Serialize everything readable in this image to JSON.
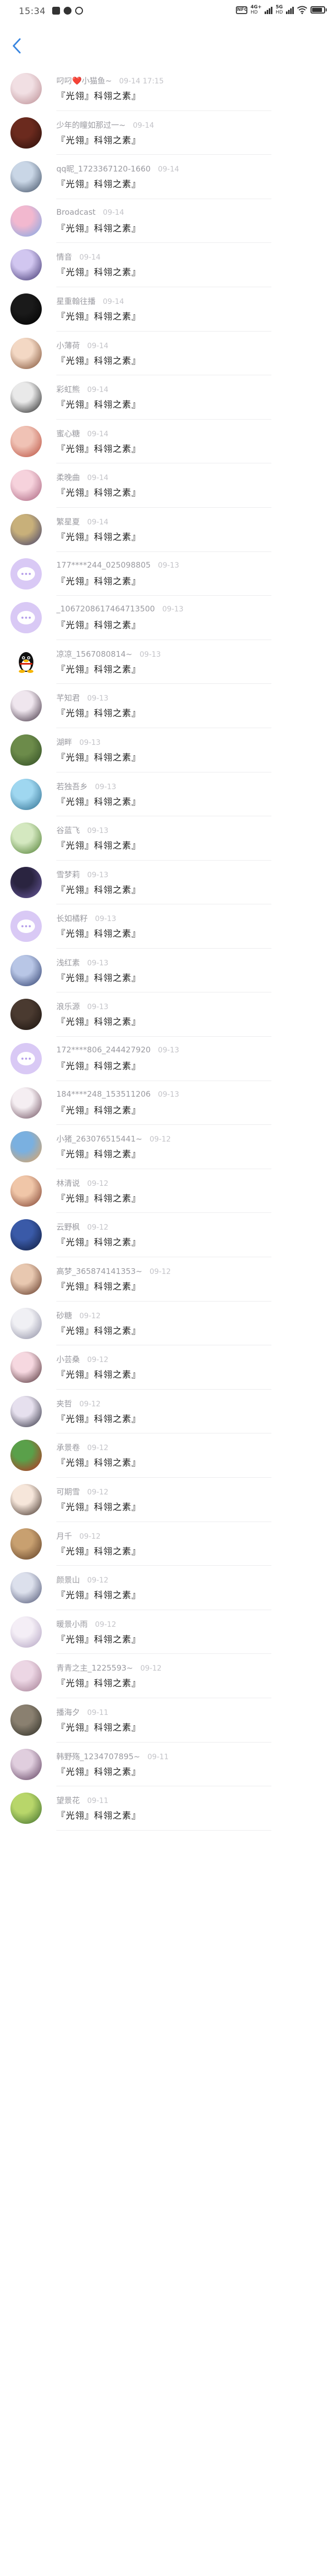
{
  "status_bar": {
    "time": "15:34",
    "nfc": "NFC",
    "network_1": {
      "top": "4G+",
      "bottom": "HD"
    },
    "network_2": {
      "top": "5G",
      "bottom": "HD"
    },
    "battery_level": 0.85
  },
  "nav": {
    "back_icon": "chevron-left-icon"
  },
  "colors": {
    "default_avatar": "#d9c9f5",
    "back": "#3a86e0"
  },
  "rows": [
    {
      "nick": "叼叼❤️小猫鱼~",
      "time": "09-14 17:15",
      "msg": "『光翎』科翎之素』",
      "avatar": [
        "#f1dfe3",
        "#b98a90"
      ]
    },
    {
      "nick": "少年的瞳如那过一~",
      "time": "09-14",
      "msg": "『光翎』科翎之素』",
      "avatar": [
        "#6b2a1e",
        "#2a0f0a"
      ]
    },
    {
      "nick": "qq昵_1723367120-1660",
      "time": "09-14",
      "msg": "『光翎』科翎之素』",
      "avatar": [
        "#c9d6e6",
        "#3b4a5f"
      ]
    },
    {
      "nick": "Broadcast",
      "time": "09-14",
      "msg": "『光翎』科翎之素』",
      "avatar": [
        "#f2b8cf",
        "#7aa7e6"
      ]
    },
    {
      "nick": "情音",
      "time": "09-14",
      "msg": "『光翎』科翎之素』",
      "avatar": [
        "#d1c6f0",
        "#3a2f6b"
      ]
    },
    {
      "nick": "星重翰往播",
      "time": "09-14",
      "msg": "『光翎』科翎之素』",
      "avatar": [
        "#1a1a1a",
        "#000000"
      ]
    },
    {
      "nick": "小薄荷",
      "time": "09-14",
      "msg": "『光翎』科翎之素』",
      "avatar": [
        "#f3d8c4",
        "#7a4a2e"
      ]
    },
    {
      "nick": "彩虹熊",
      "time": "09-14",
      "msg": "『光翎』科翎之素』",
      "avatar": [
        "#e9e9e9",
        "#1c1c1c"
      ]
    },
    {
      "nick": "蜜心糖",
      "time": "09-14",
      "msg": "『光翎』科翎之素』",
      "avatar": [
        "#f0c2b5",
        "#b84b3a"
      ]
    },
    {
      "nick": "柔晚曲",
      "time": "09-14",
      "msg": "『光翎』科翎之素』",
      "avatar": [
        "#f6d2dc",
        "#a65e7a"
      ]
    },
    {
      "nick": "繁星夏",
      "time": "09-14",
      "msg": "『光翎』科翎之素』",
      "avatar": [
        "#c8b07a",
        "#3f3d6b"
      ]
    },
    {
      "nick": "177****244_025098805",
      "time": "09-13",
      "msg": "『光翎』科翎之素』",
      "avatar": "default"
    },
    {
      "nick": "_1067208617464713500",
      "time": "09-13",
      "msg": "『光翎』科翎之素』",
      "avatar": "default"
    },
    {
      "nick": "凉凉_1567080814~",
      "time": "09-13",
      "msg": "『光翎』科翎之素』",
      "avatar": "qq"
    },
    {
      "nick": "芊知君",
      "time": "09-13",
      "msg": "『光翎』科翎之素』",
      "avatar": [
        "#efe6ee",
        "#3a2a3a"
      ]
    },
    {
      "nick": "湖畔",
      "time": "09-13",
      "msg": "『光翎』科翎之素』",
      "avatar": [
        "#6c8b4a",
        "#2e4a22"
      ]
    },
    {
      "nick": "若独吾乡",
      "time": "09-13",
      "msg": "『光翎』科翎之素』",
      "avatar": [
        "#9fd7f0",
        "#2a6a8c"
      ]
    },
    {
      "nick": "谷蓝飞",
      "time": "09-13",
      "msg": "『光翎』科翎之素』",
      "avatar": [
        "#d4e8c0",
        "#4a7a2c"
      ]
    },
    {
      "nick": "雪梦莉",
      "time": "09-13",
      "msg": "『光翎』科翎之素』",
      "avatar": [
        "#2a2440",
        "#6a5aa0"
      ]
    },
    {
      "nick": "长如橘籽",
      "time": "09-13",
      "msg": "『光翎』科翎之素』",
      "avatar": "default"
    },
    {
      "nick": "浅红素",
      "time": "09-13",
      "msg": "『光翎』科翎之素』",
      "avatar": [
        "#b8c6e6",
        "#2a3a6a"
      ]
    },
    {
      "nick": "浪乐源",
      "time": "09-13",
      "msg": "『光翎』科翎之素』",
      "avatar": [
        "#4a3a30",
        "#1a120e"
      ]
    },
    {
      "nick": "172****806_244427920",
      "time": "09-13",
      "msg": "『光翎』科翎之素』",
      "avatar": "default"
    },
    {
      "nick": "184****248_153511206",
      "time": "09-13",
      "msg": "『光翎』科翎之素』",
      "avatar": [
        "#f5eef2",
        "#6a4a5a"
      ]
    },
    {
      "nick": "小猪_263076515441~",
      "time": "09-12",
      "msg": "『光翎』科翎之素』",
      "avatar": [
        "#7ab0e0",
        "#e6a45a"
      ]
    },
    {
      "nick": "林清说",
      "time": "09-12",
      "msg": "『光翎』科翎之素』",
      "avatar": [
        "#f0c6a8",
        "#7a3a2a"
      ]
    },
    {
      "nick": "云野枫",
      "time": "09-12",
      "msg": "『光翎』科翎之素』",
      "avatar": [
        "#3a5aa8",
        "#0e1a3a"
      ]
    },
    {
      "nick": "高梦_365874141353~",
      "time": "09-12",
      "msg": "『光翎』科翎之素』",
      "avatar": [
        "#e8c8b0",
        "#5a3020"
      ]
    },
    {
      "nick": "砂糖",
      "time": "09-12",
      "msg": "『光翎』科翎之素』",
      "avatar": [
        "#f0f0f4",
        "#8a8aa0"
      ]
    },
    {
      "nick": "小芸桑",
      "time": "09-12",
      "msg": "『光翎』科翎之素』",
      "avatar": [
        "#f6d8e0",
        "#4a2a30"
      ]
    },
    {
      "nick": "夹哲",
      "time": "09-12",
      "msg": "『光翎』科翎之素』",
      "avatar": [
        "#e6e0ee",
        "#2a2a3a"
      ]
    },
    {
      "nick": "承景卷",
      "time": "09-12",
      "msg": "『光翎』科翎之素』",
      "avatar": [
        "#5aa04a",
        "#c02a20"
      ]
    },
    {
      "nick": "可期雪",
      "time": "09-12",
      "msg": "『光翎』科翎之素』",
      "avatar": [
        "#f6e6da",
        "#3a2a22"
      ]
    },
    {
      "nick": "月千",
      "time": "09-12",
      "msg": "『光翎』科翎之素』",
      "avatar": [
        "#c8a070",
        "#5a3a22"
      ]
    },
    {
      "nick": "颜景山",
      "time": "09-12",
      "msg": "『光翎』科翎之素』",
      "avatar": [
        "#dce0ec",
        "#4a5070"
      ]
    },
    {
      "nick": "暖景小雨",
      "time": "09-12",
      "msg": "『光翎』科翎之素』",
      "avatar": [
        "#f4eef6",
        "#b0a0c0"
      ]
    },
    {
      "nick": "青青之主_1225593~",
      "time": "09-12",
      "msg": "『光翎』科翎之素』",
      "avatar": [
        "#ecd6e4",
        "#a07a90"
      ]
    },
    {
      "nick": "播海夕",
      "time": "09-11",
      "msg": "『光翎』科翎之素』",
      "avatar": [
        "#8a8070",
        "#2a2a22"
      ]
    },
    {
      "nick": "韩野殇_1234707895~",
      "time": "09-11",
      "msg": "『光翎』科翎之素』",
      "avatar": [
        "#e0cede",
        "#5a3a5a"
      ]
    },
    {
      "nick": "望景花",
      "time": "09-11",
      "msg": "『光翎』科翎之素』",
      "avatar": [
        "#b8d66a",
        "#3a6a2a"
      ]
    }
  ]
}
